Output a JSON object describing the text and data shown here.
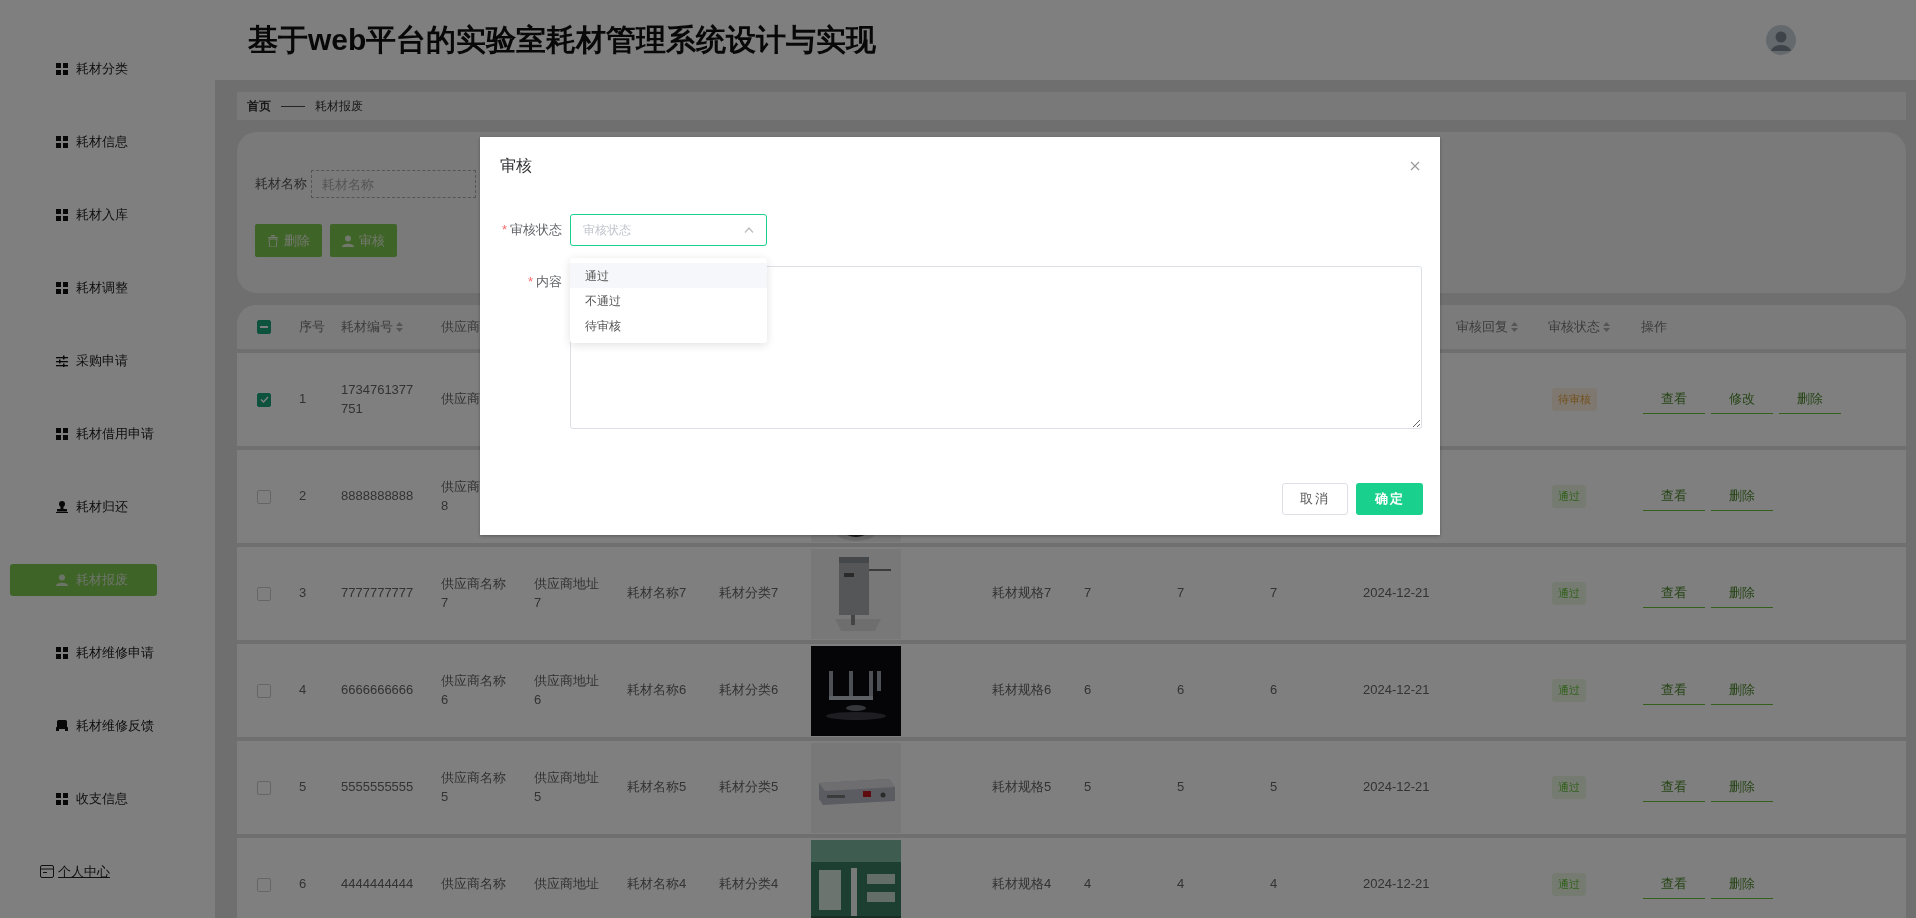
{
  "sidebar": {
    "items": [
      {
        "label": "耗材分类",
        "kind": "grid",
        "selected": false
      },
      {
        "label": "耗材信息",
        "kind": "grid",
        "selected": false
      },
      {
        "label": "耗材入库",
        "kind": "grid",
        "selected": false
      },
      {
        "label": "耗材调整",
        "kind": "grid",
        "selected": false
      },
      {
        "label": "采购申请",
        "kind": "sliders",
        "selected": false
      },
      {
        "label": "耗材借用申请",
        "kind": "grid",
        "selected": false
      },
      {
        "label": "耗材归还",
        "kind": "stamp",
        "selected": false
      },
      {
        "label": "耗材报废",
        "kind": "user",
        "selected": true
      },
      {
        "label": "耗材维修申请",
        "kind": "grid",
        "selected": false
      },
      {
        "label": "耗材维修反馈",
        "kind": "tray",
        "selected": false
      },
      {
        "label": "收支信息",
        "kind": "grid",
        "selected": false
      }
    ],
    "profile": {
      "label": "个人中心"
    }
  },
  "header": {
    "title": "基于web平台的实验室耗材管理系统设计与实现"
  },
  "breadcrumb": [
    "首页",
    "——",
    "耗材报废"
  ],
  "search": {
    "label": "耗材名称",
    "placeholder": "耗材名称"
  },
  "toolbar": [
    {
      "label": "删除",
      "kind": "trash"
    },
    {
      "label": "审核",
      "kind": "user"
    }
  ],
  "table": {
    "select_all": {
      "indeterminate": true
    },
    "columns_left": [
      {
        "label": "序号",
        "sortable": false
      },
      {
        "label": "耗材编号",
        "sortable": true
      },
      {
        "label": "供应商"
      }
    ],
    "columns_right": [
      {
        "label": "审核回复",
        "sortable": true
      },
      {
        "label": "审核状态",
        "sortable": true
      },
      {
        "label": "操作",
        "sortable": false
      }
    ],
    "rows": [
      {
        "checked": true,
        "index": "1",
        "code": "1734761377751",
        "supplier": "供应商",
        "status": {
          "label": "待审核",
          "kind": "warning"
        },
        "actions": [
          "查看",
          "修改",
          "删除"
        ]
      },
      {
        "checked": false,
        "index": "2",
        "code": "8888888888",
        "supplier": "供应商\n8",
        "column_8": {
          "kind": "picture"
        },
        "status": {
          "label": "通过",
          "kind": "success"
        },
        "actions": [
          "查看",
          "删除"
        ]
      },
      {
        "checked": false,
        "index": "3",
        "code": "7777777777",
        "supplier": "供应商名称7",
        "column_5": "供应商地址7",
        "column_6": "耗材名称7",
        "column_7": "耗材分类7",
        "column_8": {
          "kind": "picture"
        },
        "column_9": "耗材规格7",
        "column_10": "7",
        "column_11": "7",
        "column_12": "7",
        "column_13": "2024-12-21",
        "status": {
          "label": "通过",
          "kind": "success"
        },
        "actions": [
          "查看",
          "删除"
        ]
      },
      {
        "checked": false,
        "index": "4",
        "code": "6666666666",
        "supplier": "供应商名称6",
        "column_5": "供应商地址6",
        "column_6": "耗材名称6",
        "column_7": "耗材分类6",
        "column_8": {
          "kind": "picture"
        },
        "column_9": "耗材规格6",
        "column_10": "6",
        "column_11": "6",
        "column_12": "6",
        "column_13": "2024-12-21",
        "status": {
          "label": "通过",
          "kind": "success"
        },
        "actions": [
          "查看",
          "删除"
        ]
      },
      {
        "checked": false,
        "index": "5",
        "code": "5555555555",
        "supplier": "供应商名称5",
        "column_5": "供应商地址5",
        "column_6": "耗材名称5",
        "column_7": "耗材分类5",
        "column_8": {
          "kind": "picture"
        },
        "column_9": "耗材规格5",
        "column_10": "5",
        "column_11": "5",
        "column_12": "5",
        "column_13": "2024-12-21",
        "status": {
          "label": "通过",
          "kind": "success"
        },
        "actions": [
          "查看",
          "删除"
        ]
      },
      {
        "checked": false,
        "index": "6",
        "code": "4444444444",
        "supplier": "供应商名称",
        "column_5": "供应商地址",
        "column_6": "耗材名称4",
        "column_7": "耗材分类4",
        "column_8": {
          "kind": "picture"
        },
        "column_9": "耗材规格4",
        "column_10": "4",
        "column_11": "4",
        "column_12": "4",
        "column_13": "2024-12-21",
        "status": {
          "label": "通过",
          "kind": "success"
        },
        "actions": [
          "查看",
          "删除"
        ]
      }
    ]
  },
  "dialog": {
    "title": "审核",
    "fields": [
      {
        "label": "审核状态",
        "marker": "*",
        "kind": "select",
        "placeholder": "审核状态",
        "expanded": true
      },
      {
        "label": "内容",
        "marker": "*",
        "kind": "textarea"
      }
    ],
    "dropdown": [
      {
        "label": "通过",
        "hovered": true
      },
      {
        "label": "不通过",
        "hovered": false
      },
      {
        "label": "待审核",
        "hovered": false
      }
    ],
    "buttons": [
      {
        "label": "取消",
        "kind": "secondary"
      },
      {
        "label": "确定",
        "kind": "primary"
      }
    ]
  }
}
